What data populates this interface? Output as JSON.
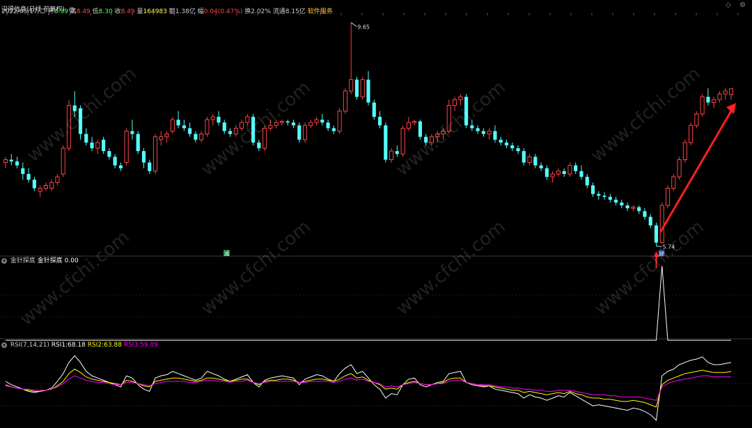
{
  "header": {
    "title": "汉得信息(日线 前复权)",
    "date": "2022/05/17/二",
    "open_label": "开",
    "open": "8.39",
    "high_label": "高",
    "high": "8.49",
    "low_label": "低",
    "low": "8.30",
    "close_label": "收",
    "close": "8.49",
    "volume_label": "量",
    "volume": "164983",
    "amount_label": "额",
    "amount": "1.38亿",
    "change_label": "幅",
    "change": "0.04(0.47%)",
    "turnover_label": "换",
    "turnover": "2.02%",
    "float_label": "流通",
    "float": "8.15亿",
    "service": "软件服务"
  },
  "corner_icons": [
    "diamond-icon",
    "settings-icon"
  ],
  "indicator1": {
    "title": "金针探底",
    "label": "金针探底",
    "value": "0.00"
  },
  "indicator2": {
    "title": "RSI(7,14,21)",
    "rsi1_label": "RSI1:",
    "rsi1": "68.18",
    "rsi2_label": "RSI2:",
    "rsi2": "63.88",
    "rsi3_label": "RSI3:",
    "rsi3": "59.09"
  },
  "annotations": {
    "high_label": "9.65",
    "low_label": "5.74",
    "mark_jian": "减",
    "mark_cai": "财"
  },
  "watermark": "www.cfchi.com",
  "colors": {
    "up": "#ff4545",
    "down": "#54ffff",
    "rsi1": "#ffffff",
    "rsi2": "#ffff00",
    "rsi3": "#ff00ff",
    "arrow": "#ff2020"
  },
  "chart_data": [
    {
      "type": "candlestick",
      "candles": [
        [
          7.2,
          7.3,
          7.1,
          7.25
        ],
        [
          7.25,
          7.35,
          7.15,
          7.22
        ],
        [
          7.22,
          7.3,
          7.1,
          7.15
        ],
        [
          7.1,
          7.2,
          6.9,
          7.0
        ],
        [
          7.0,
          7.1,
          6.85,
          6.9
        ],
        [
          6.9,
          6.95,
          6.7,
          6.75
        ],
        [
          6.7,
          6.8,
          6.6,
          6.75
        ],
        [
          6.75,
          6.85,
          6.7,
          6.8
        ],
        [
          6.75,
          6.9,
          6.7,
          6.85
        ],
        [
          6.85,
          7.0,
          6.8,
          6.95
        ],
        [
          7.0,
          7.5,
          6.95,
          7.45
        ],
        [
          7.45,
          8.3,
          7.4,
          8.2
        ],
        [
          8.2,
          8.45,
          8.0,
          8.1
        ],
        [
          8.15,
          8.2,
          7.6,
          7.7
        ],
        [
          7.7,
          7.8,
          7.5,
          7.55
        ],
        [
          7.55,
          7.65,
          7.4,
          7.45
        ],
        [
          7.45,
          7.6,
          7.35,
          7.55
        ],
        [
          7.6,
          7.65,
          7.35,
          7.4
        ],
        [
          7.4,
          7.45,
          7.25,
          7.3
        ],
        [
          7.3,
          7.35,
          7.1,
          7.15
        ],
        [
          7.15,
          7.2,
          7.05,
          7.1
        ],
        [
          7.2,
          7.8,
          7.15,
          7.75
        ],
        [
          7.75,
          7.95,
          7.6,
          7.7
        ],
        [
          7.7,
          7.75,
          7.35,
          7.4
        ],
        [
          7.4,
          7.45,
          7.1,
          7.2
        ],
        [
          7.2,
          7.25,
          7.0,
          7.05
        ],
        [
          7.05,
          7.7,
          7.0,
          7.65
        ],
        [
          7.6,
          7.75,
          7.5,
          7.65
        ],
        [
          7.65,
          7.75,
          7.55,
          7.7
        ],
        [
          7.75,
          8.0,
          7.7,
          7.95
        ],
        [
          7.95,
          8.1,
          7.8,
          7.85
        ],
        [
          7.85,
          7.95,
          7.75,
          7.8
        ],
        [
          7.8,
          7.9,
          7.65,
          7.7
        ],
        [
          7.7,
          7.75,
          7.55,
          7.6
        ],
        [
          7.6,
          7.75,
          7.55,
          7.7
        ],
        [
          7.7,
          8.0,
          7.65,
          7.95
        ],
        [
          7.95,
          8.05,
          7.85,
          8.0
        ],
        [
          8.0,
          8.1,
          7.85,
          7.9
        ],
        [
          7.9,
          7.95,
          7.7,
          7.75
        ],
        [
          7.75,
          7.8,
          7.65,
          7.7
        ],
        [
          7.7,
          7.85,
          7.65,
          7.8
        ],
        [
          7.8,
          7.95,
          7.75,
          7.9
        ],
        [
          7.9,
          8.05,
          7.85,
          8.0
        ],
        [
          8.0,
          8.05,
          7.5,
          7.55
        ],
        [
          7.55,
          7.6,
          7.4,
          7.45
        ],
        [
          7.45,
          7.85,
          7.4,
          7.8
        ],
        [
          7.8,
          7.95,
          7.75,
          7.85
        ],
        [
          7.85,
          7.95,
          7.8,
          7.9
        ],
        [
          7.9,
          7.95,
          7.85,
          7.92
        ],
        [
          7.92,
          7.95,
          7.85,
          7.9
        ],
        [
          7.9,
          7.95,
          7.8,
          7.85
        ],
        [
          7.85,
          7.9,
          7.55,
          7.6
        ],
        [
          7.6,
          7.9,
          7.55,
          7.85
        ],
        [
          7.85,
          7.95,
          7.8,
          7.9
        ],
        [
          7.9,
          8.0,
          7.85,
          7.95
        ],
        [
          7.95,
          8.05,
          7.85,
          7.9
        ],
        [
          7.9,
          7.95,
          7.75,
          7.8
        ],
        [
          7.8,
          7.85,
          7.7,
          7.75
        ],
        [
          7.75,
          8.15,
          7.7,
          8.1
        ],
        [
          8.1,
          8.5,
          8.05,
          8.45
        ],
        [
          8.45,
          9.65,
          8.4,
          8.65
        ],
        [
          8.65,
          8.7,
          8.3,
          8.35
        ],
        [
          8.35,
          8.7,
          8.3,
          8.65
        ],
        [
          8.65,
          8.8,
          8.2,
          8.25
        ],
        [
          8.25,
          8.3,
          7.95,
          8.0
        ],
        [
          8.0,
          8.1,
          7.8,
          7.85
        ],
        [
          7.85,
          7.9,
          7.2,
          7.25
        ],
        [
          7.25,
          7.45,
          7.2,
          7.4
        ],
        [
          7.4,
          7.5,
          7.3,
          7.35
        ],
        [
          7.35,
          7.85,
          7.3,
          7.8
        ],
        [
          7.8,
          8.0,
          7.75,
          7.9
        ],
        [
          7.9,
          7.95,
          7.85,
          7.92
        ],
        [
          7.92,
          7.95,
          7.6,
          7.65
        ],
        [
          7.65,
          7.7,
          7.5,
          7.55
        ],
        [
          7.55,
          7.7,
          7.5,
          7.65
        ],
        [
          7.65,
          7.75,
          7.55,
          7.7
        ],
        [
          7.7,
          7.8,
          7.6,
          7.75
        ],
        [
          7.75,
          8.3,
          7.7,
          8.2
        ],
        [
          8.2,
          8.35,
          8.1,
          8.3
        ],
        [
          8.3,
          8.4,
          8.2,
          8.35
        ],
        [
          8.35,
          8.4,
          7.8,
          7.85
        ],
        [
          7.85,
          7.95,
          7.75,
          7.8
        ],
        [
          7.8,
          7.85,
          7.7,
          7.75
        ],
        [
          7.75,
          7.8,
          7.65,
          7.7
        ],
        [
          7.7,
          7.8,
          7.6,
          7.75
        ],
        [
          7.75,
          7.85,
          7.55,
          7.6
        ],
        [
          7.6,
          7.65,
          7.5,
          7.55
        ],
        [
          7.55,
          7.6,
          7.45,
          7.5
        ],
        [
          7.5,
          7.55,
          7.4,
          7.45
        ],
        [
          7.45,
          7.5,
          7.35,
          7.4
        ],
        [
          7.4,
          7.45,
          7.15,
          7.2
        ],
        [
          7.2,
          7.35,
          7.15,
          7.3
        ],
        [
          7.3,
          7.35,
          7.1,
          7.15
        ],
        [
          7.15,
          7.2,
          7.05,
          7.1
        ],
        [
          7.1,
          7.15,
          6.9,
          6.95
        ],
        [
          6.95,
          7.05,
          6.85,
          7.0
        ],
        [
          7.0,
          7.1,
          6.95,
          7.05
        ],
        [
          7.05,
          7.1,
          6.95,
          7.0
        ],
        [
          7.0,
          7.2,
          6.95,
          7.15
        ],
        [
          7.15,
          7.2,
          7.0,
          7.05
        ],
        [
          7.05,
          7.15,
          6.9,
          6.95
        ],
        [
          6.95,
          7.0,
          6.75,
          6.8
        ],
        [
          6.8,
          6.85,
          6.6,
          6.65
        ],
        [
          6.65,
          6.7,
          6.55,
          6.62
        ],
        [
          6.62,
          6.68,
          6.55,
          6.6
        ],
        [
          6.6,
          6.65,
          6.5,
          6.55
        ],
        [
          6.55,
          6.6,
          6.45,
          6.5
        ],
        [
          6.5,
          6.55,
          6.4,
          6.45
        ],
        [
          6.45,
          6.5,
          6.35,
          6.4
        ],
        [
          6.4,
          6.45,
          6.35,
          6.42
        ],
        [
          6.42,
          6.45,
          6.3,
          6.35
        ],
        [
          6.35,
          6.4,
          6.2,
          6.25
        ],
        [
          6.25,
          6.3,
          6.05,
          6.1
        ],
        [
          6.1,
          6.15,
          5.74,
          5.8
        ],
        [
          5.8,
          6.5,
          5.78,
          6.45
        ],
        [
          6.45,
          6.8,
          6.4,
          6.75
        ],
        [
          6.75,
          7.0,
          6.7,
          6.95
        ],
        [
          6.95,
          7.3,
          6.9,
          7.25
        ],
        [
          7.25,
          7.6,
          7.2,
          7.55
        ],
        [
          7.55,
          7.9,
          7.5,
          7.85
        ],
        [
          7.85,
          8.1,
          7.8,
          8.05
        ],
        [
          8.05,
          8.4,
          8.0,
          8.35
        ],
        [
          8.35,
          8.5,
          8.2,
          8.25
        ],
        [
          8.25,
          8.35,
          8.15,
          8.3
        ],
        [
          8.3,
          8.45,
          8.25,
          8.4
        ],
        [
          8.4,
          8.5,
          8.3,
          8.45
        ],
        [
          8.39,
          8.49,
          8.3,
          8.49
        ]
      ],
      "ylim": [
        5.6,
        9.8
      ]
    },
    {
      "type": "line",
      "name": "金针探底",
      "spike_index": 114,
      "spike_value": 1,
      "baseline": 0
    },
    {
      "type": "line",
      "series": [
        {
          "name": "RSI1",
          "values": [
            55,
            52,
            50,
            48,
            46,
            45,
            46,
            47,
            49,
            55,
            62,
            72,
            78,
            72,
            64,
            60,
            58,
            56,
            54,
            52,
            50,
            60,
            58,
            52,
            48,
            46,
            58,
            60,
            61,
            64,
            62,
            60,
            58,
            56,
            58,
            64,
            62,
            60,
            57,
            55,
            57,
            59,
            61,
            54,
            50,
            56,
            58,
            59,
            60,
            59,
            58,
            52,
            57,
            59,
            61,
            60,
            57,
            55,
            62,
            67,
            70,
            62,
            64,
            58,
            52,
            48,
            40,
            44,
            43,
            52,
            57,
            58,
            52,
            50,
            52,
            54,
            55,
            62,
            63,
            64,
            54,
            52,
            51,
            50,
            51,
            48,
            47,
            46,
            45,
            44,
            40,
            43,
            41,
            40,
            38,
            40,
            42,
            41,
            45,
            42,
            39,
            36,
            33,
            34,
            33,
            32,
            31,
            30,
            29,
            31,
            30,
            28,
            25,
            20,
            60,
            64,
            66,
            70,
            72,
            74,
            75,
            77,
            72,
            70,
            70,
            71,
            72
          ]
        },
        {
          "name": "RSI2",
          "values": [
            52,
            50,
            49,
            48,
            47,
            46,
            46,
            47,
            48,
            51,
            55,
            62,
            66,
            63,
            59,
            57,
            56,
            55,
            54,
            53,
            52,
            56,
            55,
            53,
            51,
            50,
            55,
            56,
            57,
            58,
            58,
            57,
            56,
            55,
            56,
            58,
            58,
            57,
            56,
            55,
            56,
            57,
            57,
            54,
            52,
            55,
            56,
            56,
            57,
            57,
            56,
            54,
            55,
            56,
            57,
            57,
            56,
            55,
            57,
            60,
            62,
            58,
            59,
            56,
            54,
            52,
            48,
            49,
            48,
            52,
            54,
            55,
            53,
            52,
            52,
            53,
            54,
            57,
            58,
            58,
            54,
            53,
            52,
            51,
            51,
            50,
            49,
            48,
            47,
            47,
            45,
            46,
            45,
            44,
            43,
            44,
            45,
            44,
            46,
            44,
            43,
            41,
            40,
            40,
            39,
            39,
            38,
            37,
            37,
            38,
            37,
            36,
            34,
            32,
            52,
            56,
            58,
            60,
            62,
            63,
            64,
            65,
            64,
            63,
            63,
            63,
            64
          ]
        },
        {
          "name": "RSI3",
          "values": [
            51,
            50,
            49,
            48,
            48,
            47,
            47,
            47,
            48,
            50,
            53,
            57,
            60,
            58,
            56,
            55,
            54,
            54,
            53,
            52,
            52,
            54,
            54,
            53,
            52,
            51,
            53,
            54,
            55,
            55,
            55,
            55,
            54,
            54,
            55,
            56,
            56,
            55,
            55,
            54,
            55,
            55,
            56,
            54,
            53,
            54,
            55,
            55,
            55,
            55,
            55,
            54,
            54,
            55,
            55,
            55,
            55,
            54,
            55,
            57,
            58,
            56,
            57,
            55,
            54,
            53,
            50,
            51,
            50,
            52,
            53,
            54,
            53,
            52,
            52,
            53,
            53,
            55,
            56,
            56,
            54,
            53,
            52,
            52,
            52,
            51,
            50,
            50,
            49,
            49,
            48,
            48,
            47,
            47,
            46,
            46,
            47,
            47,
            47,
            46,
            45,
            44,
            43,
            43,
            43,
            42,
            42,
            41,
            41,
            41,
            41,
            40,
            39,
            38,
            50,
            53,
            55,
            56,
            57,
            58,
            59,
            60,
            60,
            59,
            59,
            59,
            59
          ]
        }
      ],
      "ylim": [
        15,
        85
      ]
    }
  ]
}
